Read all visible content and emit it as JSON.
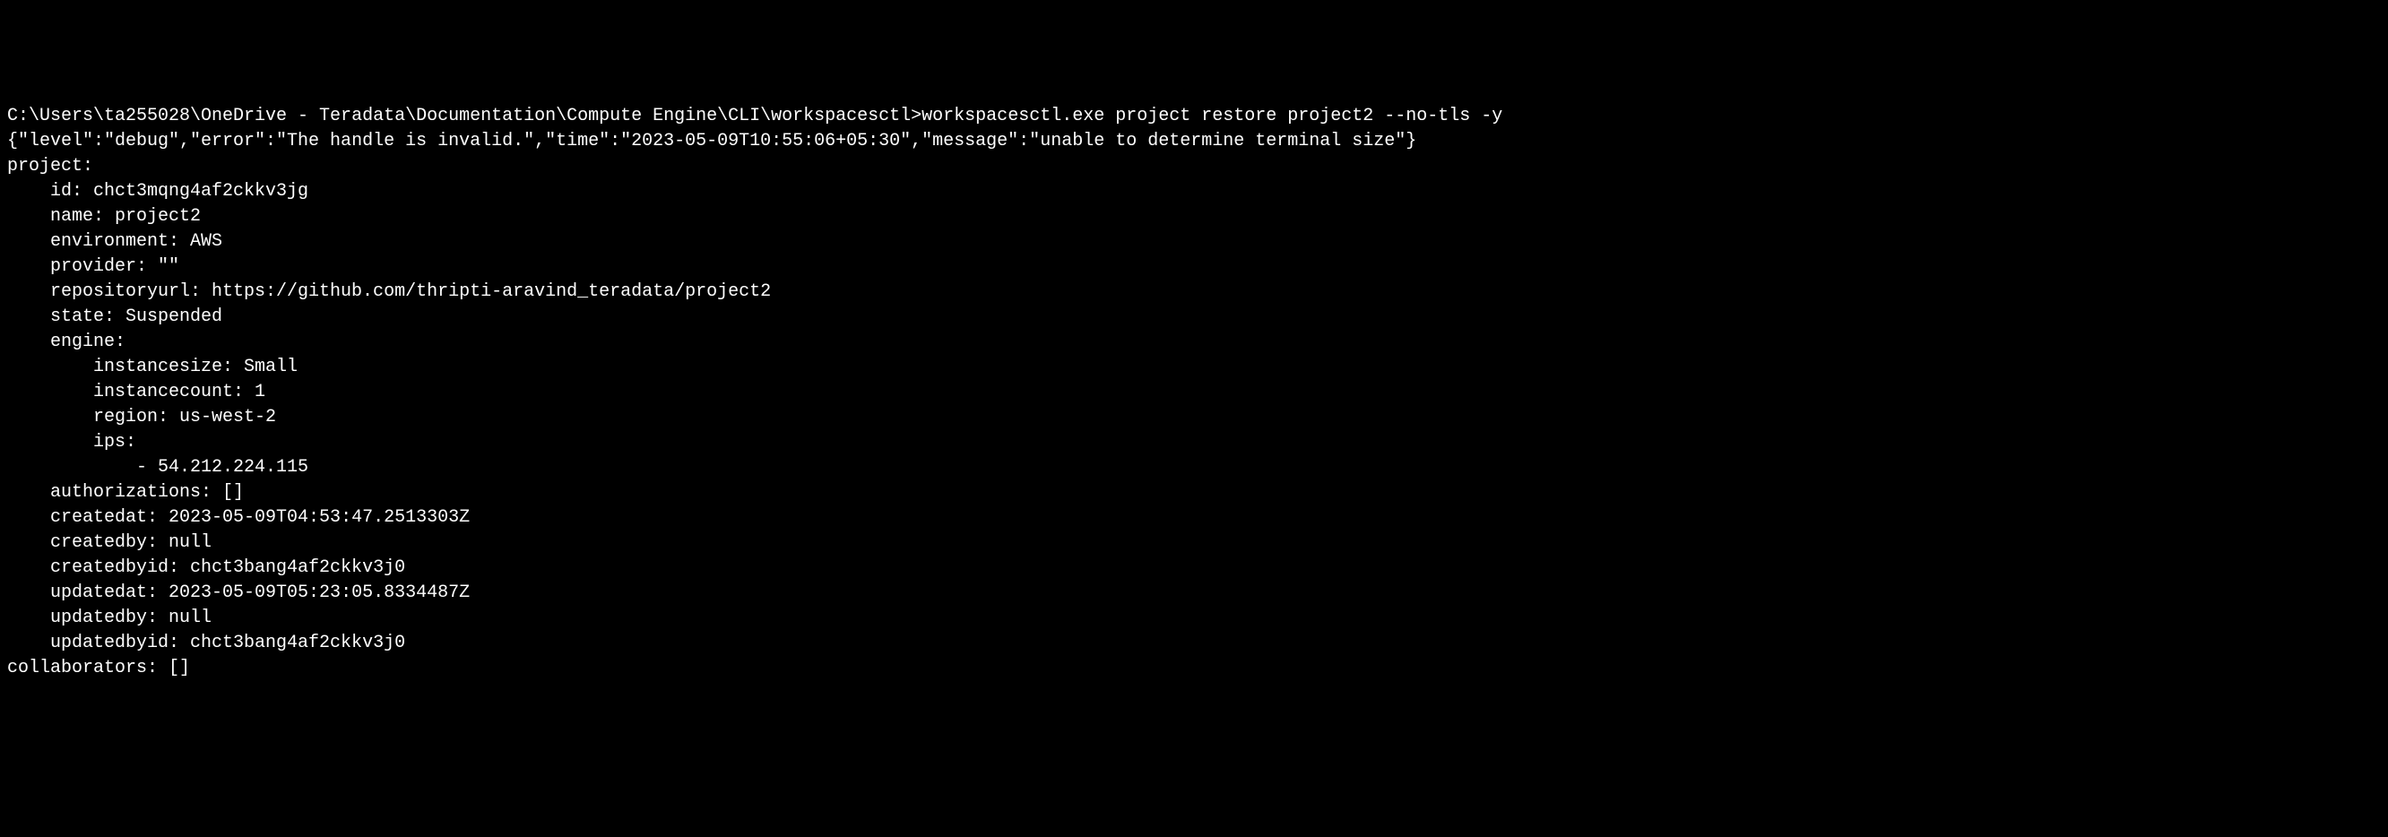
{
  "terminal": {
    "prompt": "C:\\Users\\ta255028\\OneDrive - Teradata\\Documentation\\Compute Engine\\CLI\\workspacesctl>",
    "command": "workspacesctl.exe project restore project2 --no-tls -y",
    "debug_line": "{\"level\":\"debug\",\"error\":\"The handle is invalid.\",\"time\":\"2023-05-09T10:55:06+05:30\",\"message\":\"unable to determine terminal size\"}",
    "output": {
      "project_label": "project:",
      "id_label": "id: ",
      "id_value": "chct3mqng4af2ckkv3jg",
      "name_label": "name: ",
      "name_value": "project2",
      "environment_label": "environment: ",
      "environment_value": "AWS",
      "provider_label": "provider: ",
      "provider_value": "\"\"",
      "repositoryurl_label": "repositoryurl: ",
      "repositoryurl_value": "https://github.com/thripti-aravind_teradata/project2",
      "state_label": "state: ",
      "state_value": "Suspended",
      "engine_label": "engine:",
      "instancesize_label": "instancesize: ",
      "instancesize_value": "Small",
      "instancecount_label": "instancecount: ",
      "instancecount_value": "1",
      "region_label": "region: ",
      "region_value": "us-west-2",
      "ips_label": "ips:",
      "ip_item": "- 54.212.224.115",
      "authorizations_label": "authorizations: ",
      "authorizations_value": "[]",
      "createdat_label": "createdat: ",
      "createdat_value": "2023-05-09T04:53:47.2513303Z",
      "createdby_label": "createdby: ",
      "createdby_value": "null",
      "createdbyid_label": "createdbyid: ",
      "createdbyid_value": "chct3bang4af2ckkv3j0",
      "updatedat_label": "updatedat: ",
      "updatedat_value": "2023-05-09T05:23:05.8334487Z",
      "updatedby_label": "updatedby: ",
      "updatedby_value": "null",
      "updatedbyid_label": "updatedbyid: ",
      "updatedbyid_value": "chct3bang4af2ckkv3j0",
      "collaborators_label": "collaborators: ",
      "collaborators_value": "[]"
    }
  }
}
